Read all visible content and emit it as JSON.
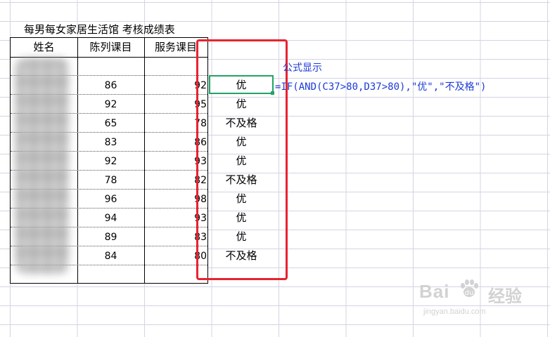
{
  "sheet": {
    "title": "每男每女家居生活馆 考核成绩表",
    "headers": {
      "name": "姓名",
      "display": "陈列课目",
      "service": "服务课目"
    },
    "rows": [
      {
        "display": "86",
        "service": "92",
        "result": "优"
      },
      {
        "display": "92",
        "service": "95",
        "result": "优"
      },
      {
        "display": "65",
        "service": "78",
        "result": "不及格"
      },
      {
        "display": "83",
        "service": "86",
        "result": "优"
      },
      {
        "display": "92",
        "service": "93",
        "result": "优"
      },
      {
        "display": "78",
        "service": "82",
        "result": "不及格"
      },
      {
        "display": "96",
        "service": "98",
        "result": "优"
      },
      {
        "display": "94",
        "service": "93",
        "result": "优"
      },
      {
        "display": "89",
        "service": "83",
        "result": "优"
      },
      {
        "display": "84",
        "service": "80",
        "result": "不及格"
      }
    ]
  },
  "annotation": {
    "caption": "公式显示",
    "formula": "=IF(AND(C37>80,D37>80),\"优\",\"不及格\")"
  },
  "watermark": {
    "brand": "Bai",
    "brand_cn": "经验",
    "url": "jingyan.baidu.com"
  },
  "colors": {
    "selection": "#21a366",
    "highlight_box": "#e8232f",
    "annotation_text": "#1d3bd6"
  },
  "icons": {
    "watermark_logo": "paw-icon"
  }
}
